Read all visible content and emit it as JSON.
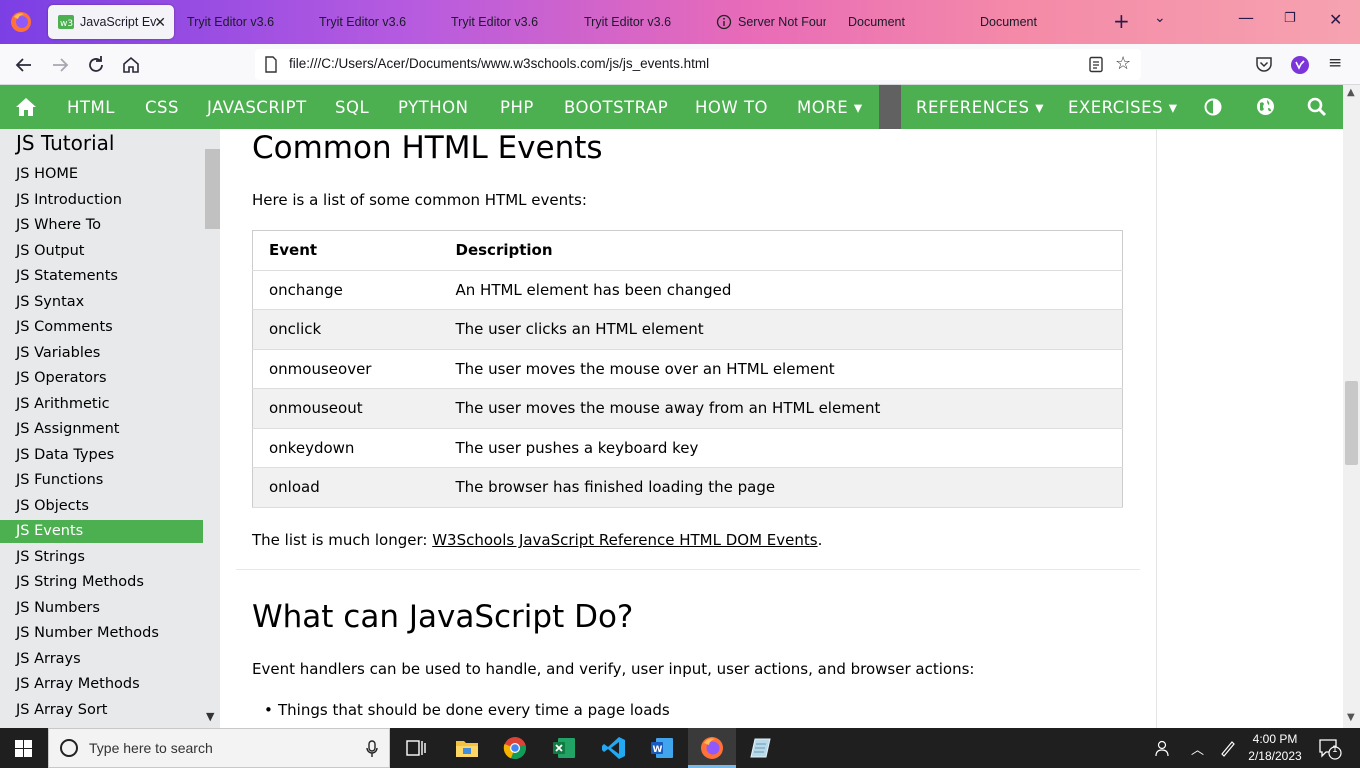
{
  "browser": {
    "tabs": [
      {
        "label": "JavaScript Eve",
        "active": true
      },
      {
        "label": "Tryit Editor v3.6"
      },
      {
        "label": "Tryit Editor v3.6"
      },
      {
        "label": "Tryit Editor v3.6"
      },
      {
        "label": "Tryit Editor v3.6"
      },
      {
        "label": "Server Not Found"
      },
      {
        "label": "Document"
      },
      {
        "label": "Document"
      }
    ],
    "url": "file:///C:/Users/Acer/Documents/www.w3schools.com/js/js_events.html"
  },
  "w3nav": {
    "items": [
      "HTML",
      "CSS",
      "JAVASCRIPT",
      "SQL",
      "PYTHON",
      "PHP",
      "BOOTSTRAP",
      "HOW TO",
      "MORE ▾",
      "REFERENCES ▾",
      "EXERCISES ▾"
    ]
  },
  "sidebar": {
    "title": "JS Tutorial",
    "items": [
      "JS HOME",
      "JS Introduction",
      "JS Where To",
      "JS Output",
      "JS Statements",
      "JS Syntax",
      "JS Comments",
      "JS Variables",
      "JS Operators",
      "JS Arithmetic",
      "JS Assignment",
      "JS Data Types",
      "JS Functions",
      "JS Objects",
      "JS Events",
      "JS Strings",
      "JS String Methods",
      "JS Numbers",
      "JS Number Methods",
      "JS Arrays",
      "JS Array Methods",
      "JS Array Sort"
    ],
    "active_index": 14
  },
  "main": {
    "heading1": "Common HTML Events",
    "intro": "Here is a list of some common HTML events:",
    "table": {
      "headers": [
        "Event",
        "Description"
      ],
      "rows": [
        [
          "onchange",
          "An HTML element has been changed"
        ],
        [
          "onclick",
          "The user clicks an HTML element"
        ],
        [
          "onmouseover",
          "The user moves the mouse over an HTML element"
        ],
        [
          "onmouseout",
          "The user moves the mouse away from an HTML element"
        ],
        [
          "onkeydown",
          "The user pushes a keyboard key"
        ],
        [
          "onload",
          "The browser has finished loading the page"
        ]
      ]
    },
    "longer_prefix": "The list is much longer: ",
    "longer_link": "W3Schools JavaScript Reference HTML DOM Events",
    "longer_suffix": ".",
    "heading2": "What can JavaScript Do?",
    "handlers_text": "Event handlers can be used to handle, and verify, user input, user actions, and browser actions:",
    "bullets": [
      "Things that should be done every time a page loads"
    ]
  },
  "taskbar": {
    "search_placeholder": "Type here to search",
    "time": "4:00 PM",
    "date": "2/18/2023",
    "notification_count": "1"
  },
  "colors": {
    "w3_green": "#4caf50",
    "sidebar_bg": "#e7e9eb",
    "taskbar_bg": "#1f1f1f"
  }
}
